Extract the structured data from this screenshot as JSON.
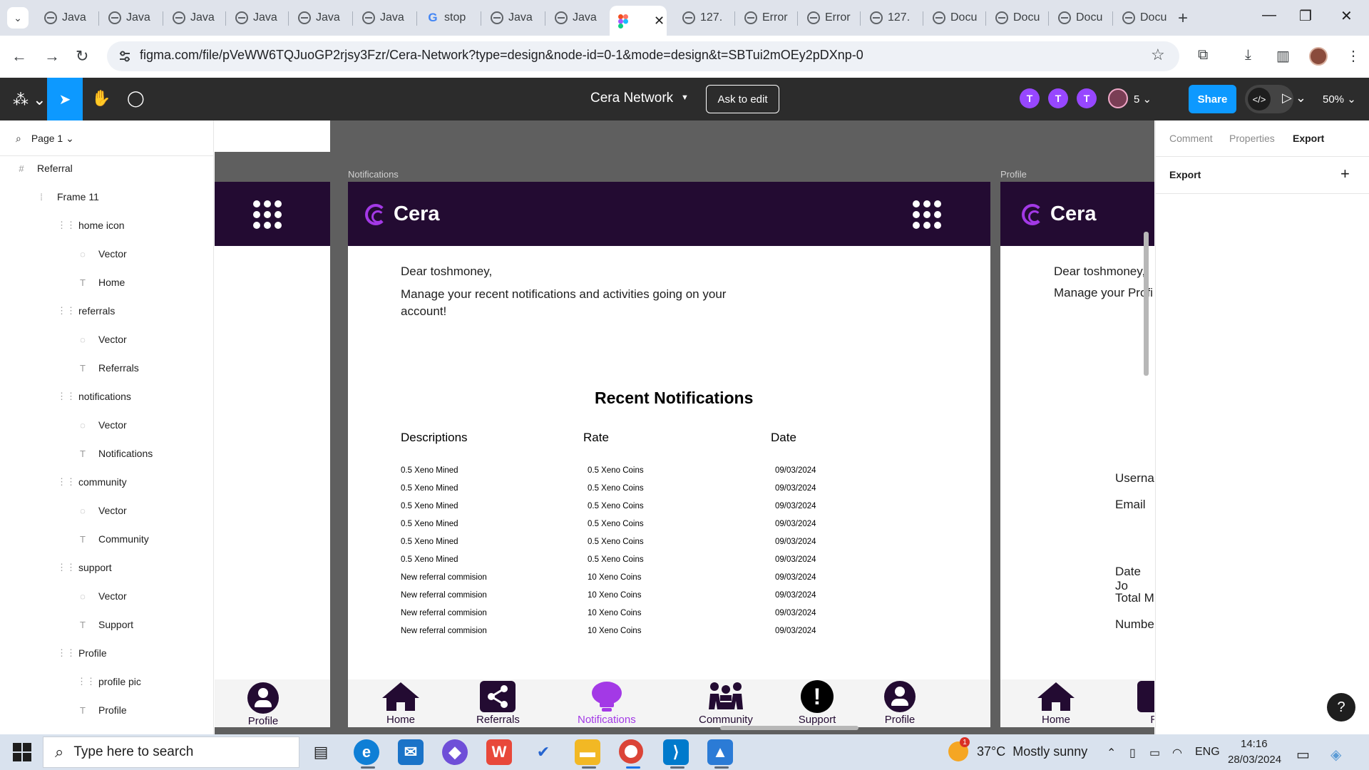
{
  "browser": {
    "tabs": [
      {
        "label": "Java",
        "favicon": "globe-icon"
      },
      {
        "label": "Java",
        "favicon": "globe-icon"
      },
      {
        "label": "Java",
        "favicon": "globe-icon"
      },
      {
        "label": "Java",
        "favicon": "globe-icon"
      },
      {
        "label": "Java",
        "favicon": "globe-icon"
      },
      {
        "label": "Java",
        "favicon": "globe-icon"
      },
      {
        "label": "stop",
        "favicon": "google-icon"
      },
      {
        "label": "Java",
        "favicon": "globe-icon"
      },
      {
        "label": "Java",
        "favicon": "globe-icon"
      },
      {
        "label": "",
        "favicon": "figma-icon",
        "active": true
      },
      {
        "label": "127.",
        "favicon": "globe-icon"
      },
      {
        "label": "Error",
        "favicon": "globe-icon"
      },
      {
        "label": "Error",
        "favicon": "globe-icon"
      },
      {
        "label": "127.",
        "favicon": "globe-icon"
      },
      {
        "label": "Docu",
        "favicon": "globe-icon"
      },
      {
        "label": "Docu",
        "favicon": "globe-icon"
      },
      {
        "label": "Docu",
        "favicon": "globe-icon"
      },
      {
        "label": "Docu",
        "favicon": "globe-icon"
      }
    ],
    "url": "figma.com/file/pVeWW6TQJuoGP2rjsy3Fzr/Cera-Network?type=design&node-id=0-1&mode=design&t=SBTui2mOEy2pDXnp-0"
  },
  "figma": {
    "file_title": "Cera Network",
    "ask_to_edit": "Ask to edit",
    "collaborators": [
      "T",
      "T",
      "T"
    ],
    "collaborator_count": "5",
    "share_label": "Share",
    "zoom": "50%",
    "accent": "#0d99ff"
  },
  "layers": {
    "page": "Page 1",
    "items": [
      {
        "name": "Referral",
        "icon": "frame-icon"
      },
      {
        "name": "Frame 11",
        "icon": "auto-layout-icon"
      },
      {
        "name": "home icon",
        "icon": "group-icon"
      },
      {
        "name": "Vector",
        "icon": "vector-icon"
      },
      {
        "name": "Home",
        "icon": "text-icon"
      },
      {
        "name": "referrals",
        "icon": "group-icon"
      },
      {
        "name": "Vector",
        "icon": "vector-icon"
      },
      {
        "name": "Referrals",
        "icon": "text-icon"
      },
      {
        "name": "notifications",
        "icon": "group-icon"
      },
      {
        "name": "Vector",
        "icon": "vector-icon"
      },
      {
        "name": "Notifications",
        "icon": "text-icon"
      },
      {
        "name": "community",
        "icon": "group-icon"
      },
      {
        "name": "Vector",
        "icon": "vector-icon"
      },
      {
        "name": "Community",
        "icon": "text-icon"
      },
      {
        "name": "support",
        "icon": "group-icon"
      },
      {
        "name": "Vector",
        "icon": "vector-icon"
      },
      {
        "name": "Support",
        "icon": "text-icon"
      },
      {
        "name": "Profile",
        "icon": "group-icon"
      },
      {
        "name": "profile pic",
        "icon": "group-icon"
      },
      {
        "name": "Profile",
        "icon": "text-icon"
      }
    ]
  },
  "canvas": {
    "notifications_frame_label": "Notifications",
    "profile_frame_label": "Profile",
    "brand": "Cera",
    "brand_color": "#230b32",
    "accent_color": "#a339e6",
    "greeting": "Dear toshmoney,",
    "manage_text": "Manage your recent notifications and activities going on your account!",
    "recent_title": "Recent Notifications",
    "columns": [
      "Descriptions",
      "Rate",
      "Date"
    ],
    "rows": [
      [
        "0.5 Xeno Mined",
        "0.5 Xeno Coins",
        "09/03/2024"
      ],
      [
        "0.5 Xeno Mined",
        "0.5 Xeno Coins",
        "09/03/2024"
      ],
      [
        "0.5 Xeno Mined",
        "0.5 Xeno Coins",
        "09/03/2024"
      ],
      [
        "0.5 Xeno Mined",
        "0.5 Xeno Coins",
        "09/03/2024"
      ],
      [
        "0.5 Xeno Mined",
        "0.5 Xeno Coins",
        "09/03/2024"
      ],
      [
        "0.5 Xeno Mined",
        "0.5 Xeno Coins",
        "09/03/2024"
      ],
      [
        "New referral commision",
        "10 Xeno Coins",
        "09/03/2024"
      ],
      [
        "New referral commision",
        "10 Xeno Coins",
        "09/03/2024"
      ],
      [
        "New referral commision",
        "10 Xeno Coins",
        "09/03/2024"
      ],
      [
        "New referral commision",
        "10 Xeno Coins",
        "09/03/2024"
      ]
    ],
    "nav": {
      "home": "Home",
      "referrals": "Referrals",
      "notifications": "Notifications",
      "community": "Community",
      "support": "Support",
      "profile": "Profile"
    },
    "profile_frame": {
      "greeting": "Dear toshmoney,",
      "manage_text": "Manage your Profi",
      "fields": [
        "Userna",
        "Email",
        "Date Jo",
        "Total M",
        "Numbe"
      ],
      "nav_home": "Home",
      "nav_referrals_partial": "Re"
    },
    "left_frame_nav_profile": "Profile"
  },
  "right_panel": {
    "tabs": [
      "Comment",
      "Properties",
      "Export"
    ],
    "active_tab": "Export",
    "section": "Export",
    "help": "?"
  },
  "taskbar": {
    "search_placeholder": "Type here to search",
    "weather_temp": "37°C",
    "weather_desc": "Mostly sunny",
    "weather_badge": "1",
    "language": "ENG",
    "time": "14:16",
    "date": "28/03/2024"
  }
}
